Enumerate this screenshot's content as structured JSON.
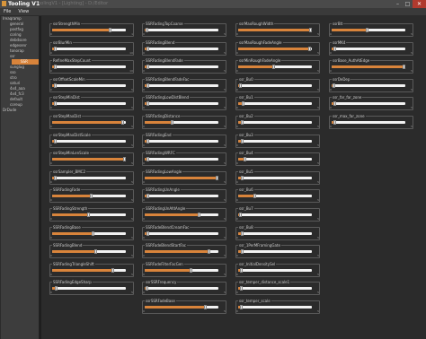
{
  "window": {
    "title": "Tooling V1",
    "faded_title": "ToolingV1 - [Lighting] - D:/Editor"
  },
  "menu": [
    "File",
    "View"
  ],
  "sidebar": {
    "items": [
      {
        "label": "Ireaqramp",
        "indent": 0,
        "selected": false
      },
      {
        "label": "general",
        "indent": 1,
        "selected": false
      },
      {
        "label": "postfxg",
        "indent": 1,
        "selected": false
      },
      {
        "label": "coring",
        "indent": 1,
        "selected": false
      },
      {
        "label": "debdsore",
        "indent": 1,
        "selected": false
      },
      {
        "label": "edgesenr",
        "indent": 1,
        "selected": false
      },
      {
        "label": "tonorap",
        "indent": 1,
        "selected": false
      },
      {
        "label": "ssr",
        "indent": 1,
        "selected": false
      },
      {
        "label": "SSR",
        "indent": 1,
        "selected": true
      },
      {
        "label": "sunglug",
        "indent": 1,
        "selected": false
      },
      {
        "label": "sso",
        "indent": 1,
        "selected": false
      },
      {
        "label": "stro",
        "indent": 1,
        "selected": false
      },
      {
        "label": "saturi",
        "indent": 1,
        "selected": false
      },
      {
        "label": "4x4_aaa",
        "indent": 1,
        "selected": false
      },
      {
        "label": "4x4_fc3",
        "indent": 1,
        "selected": false
      },
      {
        "label": "default",
        "indent": 1,
        "selected": false
      },
      {
        "label": "coreup",
        "indent": 1,
        "selected": false
      },
      {
        "label": "DrDude",
        "indent": 0,
        "selected": false
      }
    ]
  },
  "columns": [
    {
      "sliders": [
        {
          "label": "ssrStrengthMin",
          "fill": 0.78,
          "min": "0",
          "max": "1"
        },
        {
          "label": "ssrBlurMin",
          "fill": 0.04,
          "min": "0",
          "max": "10"
        },
        {
          "label": "RefineMaxStepCount",
          "fill": 0.04,
          "min": "0",
          "max": "10"
        },
        {
          "label": "ssrOffsetScaleMin",
          "fill": 0.04,
          "min": "0",
          "max": "5"
        },
        {
          "label": "ssrStepMinDist",
          "fill": 0.04,
          "min": "0",
          "max": "5"
        },
        {
          "label": "ssrStepMaxDist",
          "fill": 0.95,
          "min": "0",
          "max": "5"
        },
        {
          "label": "ssrStepMaxDistScale",
          "fill": 0.04,
          "min": "0",
          "max": "5"
        },
        {
          "label": "ssrStepMinLenScale",
          "fill": 0.97,
          "min": "0",
          "max": "5"
        },
        {
          "label": "ssrSampler_BMC2",
          "fill": 0.04,
          "min": "0",
          "max": "5"
        },
        {
          "label": "SSRFadingFade",
          "fill": 0.52,
          "min": "0",
          "max": "5"
        },
        {
          "label": "SSRFadingStrength",
          "fill": 0.49,
          "min": "0",
          "max": "5"
        },
        {
          "label": "SSRFadingBase",
          "fill": 0.55,
          "min": "0",
          "max": "5"
        },
        {
          "label": "SSRFadingBlend",
          "fill": 0.58,
          "min": "0",
          "max": "5"
        },
        {
          "label": "SSRFadingTriangleShift",
          "fill": 0.82,
          "min": "0",
          "max": "5"
        },
        {
          "label": "SSRFadingEdgeSharp",
          "fill": 0.05,
          "min": "0",
          "max": "5"
        }
      ]
    },
    {
      "sliders": [
        {
          "label": "SSRFadingTopCoarse",
          "fill": 0.03,
          "min": "0",
          "max": "5"
        },
        {
          "label": "SSRFadingBlend",
          "fill": 0.04,
          "min": "0",
          "max": "5"
        },
        {
          "label": "SSRFadingBlendFade",
          "fill": 0.04,
          "min": "0",
          "max": "5"
        },
        {
          "label": "SSRFadingBlendFadeFac",
          "fill": 0.04,
          "min": "0",
          "max": "5"
        },
        {
          "label": "SSRFadingLowDistBlend",
          "fill": 0.04,
          "min": "0",
          "max": "5"
        },
        {
          "label": "SSRFadingDistance",
          "fill": 0.36,
          "min": "0",
          "max": "5"
        },
        {
          "label": "SSRFadingEnd",
          "fill": 0.04,
          "min": "0",
          "max": "5"
        },
        {
          "label": "SSRFadingWRFC",
          "fill": 0.04,
          "min": "0",
          "max": "5"
        },
        {
          "label": "SSRFadingLowAngle",
          "fill": 0.97,
          "min": "0",
          "max": "5"
        },
        {
          "label": "SSRFadingUnAngle",
          "fill": 0.04,
          "min": "0",
          "max": "5"
        },
        {
          "label": "SSRFadingUnAfdAngle",
          "fill": 0.73,
          "min": "0",
          "max": "5"
        },
        {
          "label": "SSRFadeBlendCreamFac",
          "fill": 0.04,
          "min": "0",
          "max": "5"
        },
        {
          "label": "SSRFadeBlendStartFac",
          "fill": 0.86,
          "min": "0",
          "max": "5"
        },
        {
          "label": "SSRFadeFilterFacGen",
          "fill": 0.62,
          "min": "0",
          "max": "5"
        },
        {
          "label": "ssrSSRFrequency",
          "fill": 0.03,
          "min": "0",
          "max": "5"
        },
        {
          "label": "ssrSSRFadeBase",
          "fill": 0.82,
          "min": "0",
          "max": "5"
        }
      ]
    },
    {
      "sliders": [
        {
          "label": "ssrMaxRoughWidth",
          "fill": 0.98,
          "min": "0",
          "max": "5"
        },
        {
          "label": "ssrMaxRoughFadeAngle",
          "fill": 0.96,
          "min": "0",
          "max": "5"
        },
        {
          "label": "ssrMinRoughFadeAngle",
          "fill": 0.48,
          "min": "0",
          "max": "5"
        },
        {
          "label": "ssr_Bu0",
          "fill": 0.02,
          "min": "0",
          "max": "5"
        },
        {
          "label": "ssr_Bu1",
          "fill": 0.06,
          "min": "0",
          "max": "5"
        },
        {
          "label": "ssr_Bu2",
          "fill": 0.05,
          "min": "0",
          "max": "5"
        },
        {
          "label": "ssr_Bu3",
          "fill": 0.05,
          "min": "0",
          "max": "5"
        },
        {
          "label": "ssr_Bu4",
          "fill": 0.08,
          "min": "0",
          "max": "5"
        },
        {
          "label": "ssr_Bu5",
          "fill": 0.05,
          "min": "0",
          "max": "5"
        },
        {
          "label": "ssr_Bu6",
          "fill": 0.22,
          "min": "0",
          "max": "5"
        },
        {
          "label": "ssr_Bu7",
          "fill": 0.02,
          "min": "0",
          "max": "5"
        },
        {
          "label": "ssr_Bu8",
          "fill": 0.05,
          "min": "0",
          "max": "5"
        },
        {
          "label": "ssr_1PerMFramingGate",
          "fill": 0.05,
          "min": "0",
          "max": "5"
        },
        {
          "label": "ssr_InitialDensitySel",
          "fill": 0.04,
          "min": "0",
          "max": "5"
        },
        {
          "label": "ssr_temper_distance_scale1",
          "fill": 0.04,
          "min": "0",
          "max": "5"
        },
        {
          "label": "ssr_temper_scale",
          "fill": 0.04,
          "min": "0",
          "max": "5"
        }
      ]
    },
    {
      "sliders": [
        {
          "label": "ssrBlt",
          "fill": 0.48,
          "min": "0",
          "max": "5"
        },
        {
          "label": "ssrMK4",
          "fill": 0.04,
          "min": "0",
          "max": "5"
        },
        {
          "label": "ssrBase_AuthAtEdge",
          "fill": 0.97,
          "min": "0",
          "max": "5"
        },
        {
          "label": "ssrDeDep",
          "fill": 0.03,
          "min": "0",
          "max": "5"
        },
        {
          "label": "ssr_far_far_zone",
          "fill": 0.04,
          "min": "0",
          "max": "5"
        },
        {
          "label": "ssr_max_far_zone",
          "fill": 0.04,
          "min": "0",
          "max": "5"
        }
      ]
    }
  ]
}
